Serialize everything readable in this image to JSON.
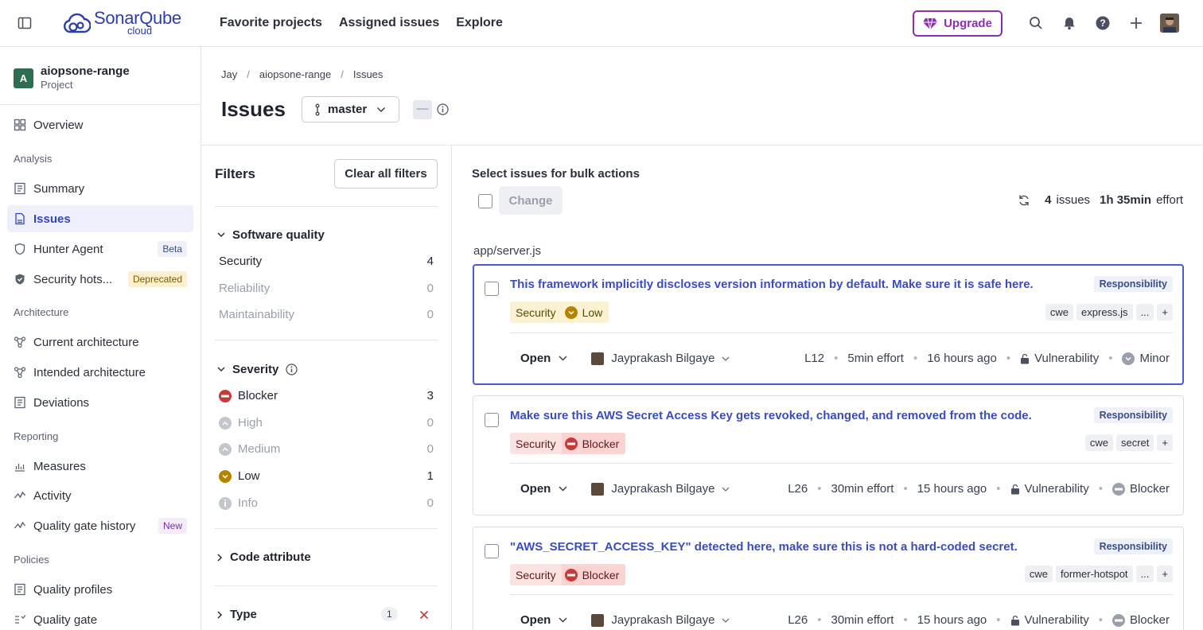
{
  "app": {
    "logo_main": "SonarQube",
    "logo_sub": "cloud"
  },
  "topnav": {
    "items": [
      "Favorite projects",
      "Assigned issues",
      "Explore"
    ],
    "upgrade": "Upgrade"
  },
  "project": {
    "badge": "A",
    "name": "aiopsone-range",
    "type": "Project"
  },
  "sidebar": {
    "overview": "Overview",
    "analysis_head": "Analysis",
    "summary": "Summary",
    "issues": "Issues",
    "hunter": "Hunter Agent",
    "hunter_tag": "Beta",
    "hotspots": "Security hots...",
    "hotspots_tag": "Deprecated",
    "architecture_head": "Architecture",
    "current_arch": "Current architecture",
    "intended_arch": "Intended architecture",
    "deviations": "Deviations",
    "reporting_head": "Reporting",
    "measures": "Measures",
    "activity": "Activity",
    "qg_history": "Quality gate history",
    "qg_history_tag": "New",
    "policies_head": "Policies",
    "quality_profiles": "Quality profiles",
    "quality_gate": "Quality gate"
  },
  "breadcrumb": [
    "Jay",
    "aiopsone-range",
    "Issues"
  ],
  "page": {
    "title": "Issues",
    "branch": "master",
    "dash": "—"
  },
  "filters": {
    "title": "Filters",
    "clear": "Clear all filters",
    "software_quality": {
      "label": "Software quality",
      "rows": [
        {
          "name": "Security",
          "count": "4"
        },
        {
          "name": "Reliability",
          "count": "0"
        },
        {
          "name": "Maintainability",
          "count": "0"
        }
      ]
    },
    "severity": {
      "label": "Severity",
      "rows": [
        {
          "name": "Blocker",
          "count": "3"
        },
        {
          "name": "High",
          "count": "0"
        },
        {
          "name": "Medium",
          "count": "0"
        },
        {
          "name": "Low",
          "count": "1"
        },
        {
          "name": "Info",
          "count": "0"
        }
      ]
    },
    "code_attribute": "Code attribute",
    "type": {
      "label": "Type",
      "count": "1"
    }
  },
  "bulk": {
    "label": "Select issues for bulk actions",
    "change": "Change"
  },
  "summary": {
    "count": "4",
    "count_unit": "issues",
    "effort": "1h 35min",
    "effort_unit": "effort"
  },
  "file": "app/server.js",
  "issues": [
    {
      "title": "This framework implicitly discloses version information by default. Make sure it is safe here.",
      "responsibility": "Responsibility",
      "quality": "Security",
      "severity": "Low",
      "tags": [
        "cwe",
        "express.js",
        "...",
        "+"
      ],
      "status": "Open",
      "assignee": "Jayprakash Bilgaye",
      "line": "L12",
      "effort": "5min effort",
      "age": "16 hours ago",
      "type": "Vulnerability",
      "legacy_severity": "Minor"
    },
    {
      "title": "Make sure this AWS Secret Access Key gets revoked, changed, and removed from the code.",
      "responsibility": "Responsibility",
      "quality": "Security",
      "severity": "Blocker",
      "tags": [
        "cwe",
        "secret",
        "+"
      ],
      "status": "Open",
      "assignee": "Jayprakash Bilgaye",
      "line": "L26",
      "effort": "30min effort",
      "age": "15 hours ago",
      "type": "Vulnerability",
      "legacy_severity": "Blocker"
    },
    {
      "title": "\"AWS_SECRET_ACCESS_KEY\" detected here, make sure this is not a hard-coded secret.",
      "responsibility": "Responsibility",
      "quality": "Security",
      "severity": "Blocker",
      "tags": [
        "cwe",
        "former-hotspot",
        "...",
        "+"
      ],
      "status": "Open",
      "assignee": "Jayprakash Bilgaye",
      "line": "L26",
      "effort": "30min effort",
      "age": "15 hours ago",
      "type": "Vulnerability",
      "legacy_severity": "Blocker"
    }
  ],
  "colors": {
    "accent": "#3146c0",
    "upgrade": "#8c2fb5",
    "blocker": "#c73a3a",
    "low": "#b38400"
  }
}
